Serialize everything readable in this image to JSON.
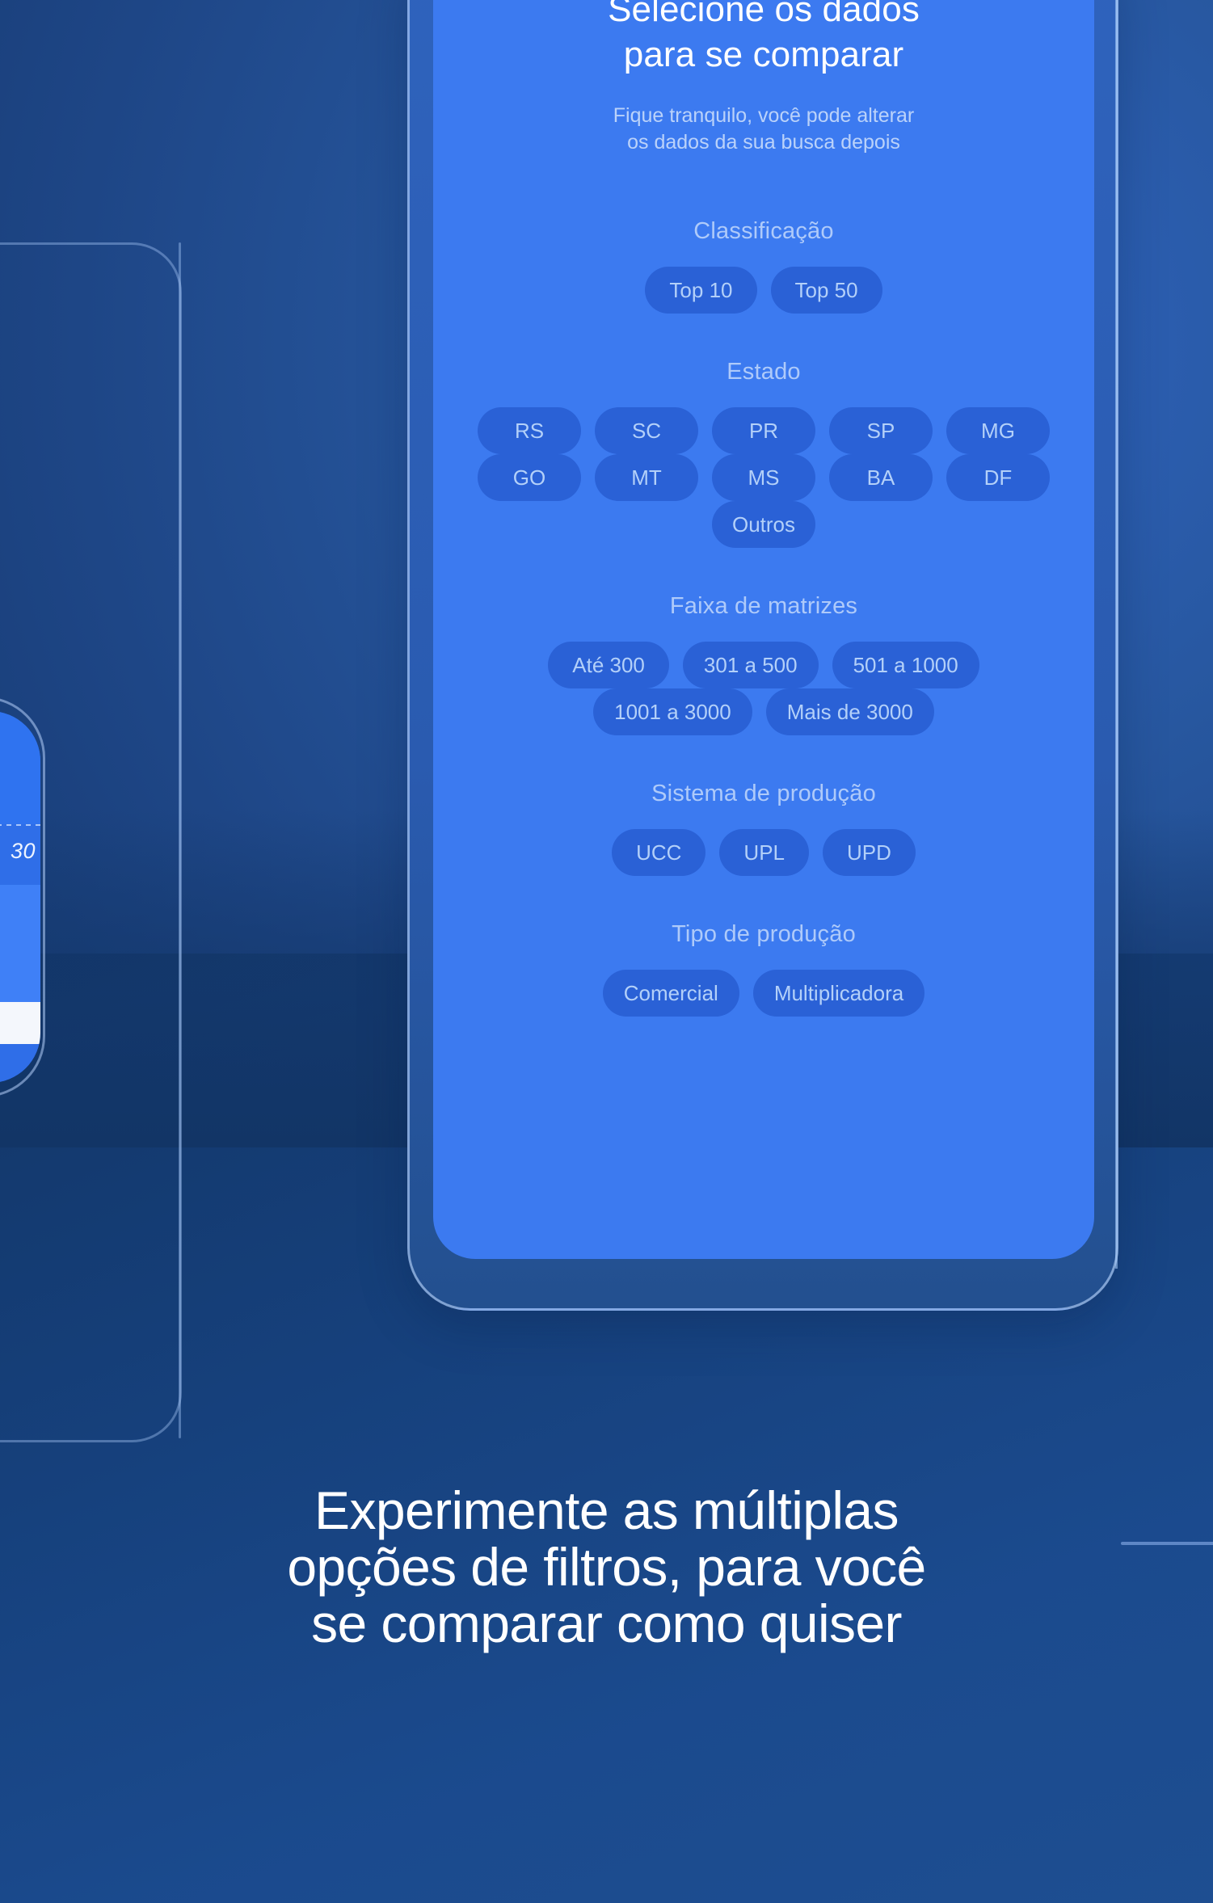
{
  "screen": {
    "title": "Selecione os dados\npara se comparar",
    "title_line1": "Selecione os dados",
    "title_line2": "para se comparar",
    "subtitle_line1": "Fique tranquilo, você pode alterar",
    "subtitle_line2": "os dados da sua busca depois",
    "groups": [
      {
        "label": "Classificação",
        "rows": [
          [
            "Top 10",
            "Top 50"
          ]
        ]
      },
      {
        "label": "Estado",
        "rows": [
          [
            "RS",
            "SC",
            "PR",
            "SP",
            "MG"
          ],
          [
            "GO",
            "MT",
            "MS",
            "BA",
            "DF"
          ],
          [
            "Outros"
          ]
        ]
      },
      {
        "label": "Faixa de matrizes",
        "rows": [
          [
            "Até 300",
            "301 a 500",
            "501 a 1000"
          ],
          [
            "1001 a 3000",
            "Mais de 3000"
          ]
        ]
      },
      {
        "label": "Sistema de produção",
        "rows": [
          [
            "UCC",
            "UPL",
            "UPD"
          ]
        ]
      },
      {
        "label": "Tipo de produção",
        "rows": [
          [
            "Comercial",
            "Multiplicadora"
          ]
        ]
      }
    ]
  },
  "left_phone_preview": {
    "value_label": "30"
  },
  "caption": {
    "line1": "Experimente as múltiplas",
    "line2": "opções de filtros, para você",
    "line3": "se comparar como quiser"
  },
  "colors": {
    "page_background_top": "#2f63bd",
    "page_background_bottom": "#123566",
    "phone_screen": "#3c7af0",
    "phone_bezel": "#2a5bb0",
    "chip_background": "#2a61d6",
    "chip_text": "#b3d0f9",
    "title_text": "#ffffff",
    "group_label_text": "#cbdffc",
    "caption_text": "#ffffff",
    "outline_stroke": "#a8c8f8"
  }
}
